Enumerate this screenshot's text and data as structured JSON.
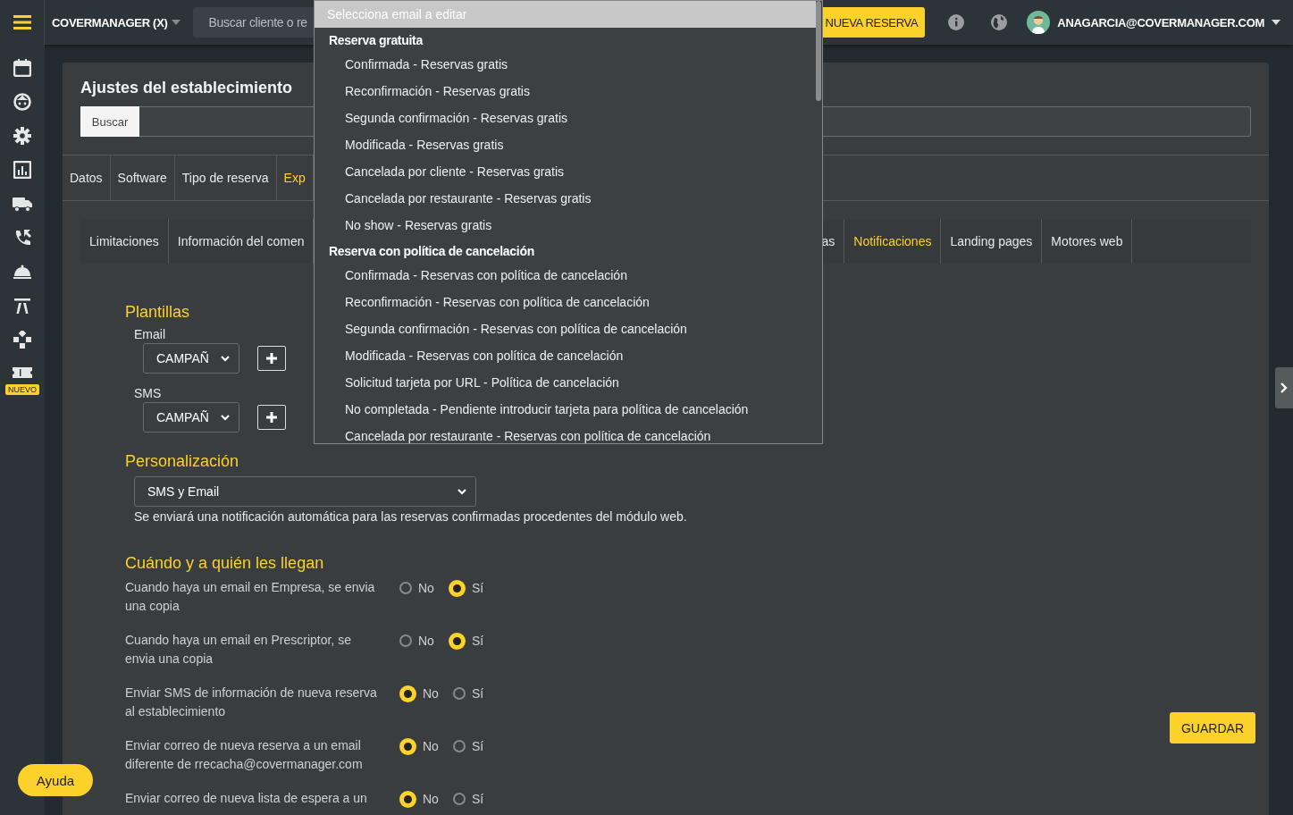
{
  "topbar": {
    "brand": "COVERMANAGER (X)",
    "search": {
      "placeholder": "Buscar cliente o re"
    },
    "new_button": "NUEVA RESERVA",
    "user": "ANAGARCIA@COVERMANAGER.COM"
  },
  "sidebar": {
    "badge": "NUEVO"
  },
  "panel": {
    "title": "Ajustes del establecimiento",
    "search_button": "Buscar"
  },
  "tabs": [
    {
      "label": "Datos",
      "selected": false
    },
    {
      "label": "Software",
      "selected": false
    },
    {
      "label": "Tipo de reserva",
      "selected": false
    },
    {
      "label": "Exp",
      "selected": true
    }
  ],
  "subtabs_left": [
    {
      "label": "Limitaciones",
      "selected": false
    },
    {
      "label": "Información del comen",
      "selected": false
    }
  ],
  "subtabs_right": [
    {
      "label": "as",
      "selected": false
    },
    {
      "label": "Notificaciones",
      "selected": true
    },
    {
      "label": "Landing pages",
      "selected": false
    },
    {
      "label": "Motores web",
      "selected": false
    }
  ],
  "plantillas": {
    "title": "Plantillas",
    "fields": [
      {
        "label": "Email",
        "value": "CAMPAÑ"
      },
      {
        "label": "SMS",
        "value": "CAMPAÑ"
      }
    ]
  },
  "personalizacion": {
    "title": "Personalización",
    "value": "SMS y Email",
    "help": "Se enviará una notificación automática para las reservas confirmadas procedentes del módulo web."
  },
  "recipients": {
    "title": "Cuándo y a quién les llegan",
    "rows": [
      {
        "text": "Cuando haya un email en Empresa, se envia una copia",
        "options": [
          {
            "label": "No",
            "selected": false
          },
          {
            "label": "Sí",
            "selected": true
          }
        ]
      },
      {
        "text": "Cuando haya un email en Prescriptor, se envia una copia",
        "options": [
          {
            "label": "No",
            "selected": false
          },
          {
            "label": "Sí",
            "selected": true
          }
        ]
      },
      {
        "text": "Enviar SMS de información de nueva reserva al establecimiento",
        "options": [
          {
            "label": "No",
            "selected": true
          },
          {
            "label": "Sí",
            "selected": false
          }
        ]
      },
      {
        "text": "Enviar correo de nueva reserva a un email diferente de rrecacha@covermanager.com",
        "options": [
          {
            "label": "No",
            "selected": true
          },
          {
            "label": "Sí",
            "selected": false
          }
        ]
      },
      {
        "text": "Enviar correo de nueva lista de espera a un",
        "options": [
          {
            "label": "No",
            "selected": true
          },
          {
            "label": "Sí",
            "selected": false
          }
        ]
      }
    ]
  },
  "save_button": "GUARDAR",
  "help_button": "Ayuda",
  "dropdown": {
    "header": "Selecciona email a editar",
    "groups": [
      {
        "label": "Reserva gratuita",
        "items": [
          "Confirmada - Reservas gratis",
          "Reconfirmación - Reservas gratis",
          "Segunda confirmación - Reservas gratis",
          "Modificada - Reservas gratis",
          "Cancelada por cliente - Reservas gratis",
          "Cancelada por restaurante - Reservas gratis",
          "No show - Reservas gratis"
        ]
      },
      {
        "label": "Reserva con política de cancelación",
        "items": [
          "Confirmada - Reservas con política de cancelación",
          "Reconfirmación - Reservas con política de cancelación",
          "Segunda confirmación - Reservas con política de cancelación",
          "Modificada - Reservas con política de cancelación",
          "Solicitud tarjeta por URL - Política de cancelación",
          "No completada - Pendiente introducir tarjeta para política de cancelación",
          "Cancelada por restaurante - Reservas con política de cancelación"
        ]
      }
    ]
  }
}
